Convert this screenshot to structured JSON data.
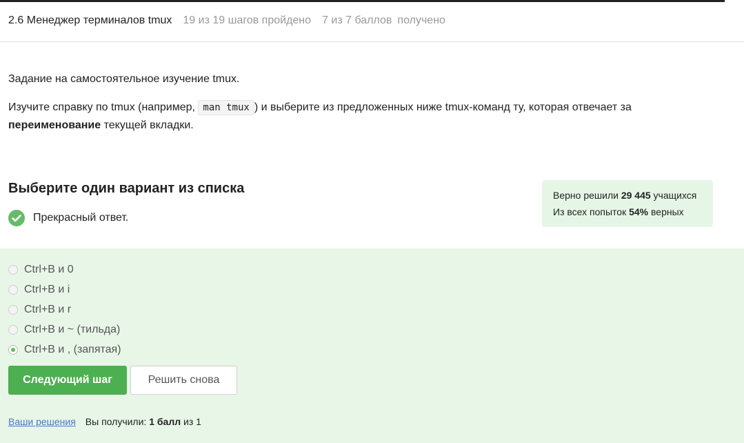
{
  "header": {
    "lesson_title": "2.6 Менеджер терминалов tmux",
    "steps_progress": "19 из 19 шагов пройдено",
    "points": "7 из 7 баллов",
    "points_suffix": "получено"
  },
  "task": {
    "line1": "Задание на самостоятельное изучение tmux.",
    "line2_before": "Изучите справку по tmux (например, ",
    "line2_code": "man tmux",
    "line2_after": ") и выберите из предложенных ниже tmux-команд ту, которая отвечает за",
    "line3_bold": "переименование",
    "line3_after": " текущей вкладки."
  },
  "question": {
    "title": "Выберите один вариант из списка",
    "feedback": "Прекрасный ответ."
  },
  "stats": {
    "solved_prefix": "Верно решили ",
    "solved_count": "29 445",
    "solved_suffix": " учащихся",
    "attempts_prefix": "Из всех попыток ",
    "attempts_percent": "54%",
    "attempts_suffix": " верных"
  },
  "options": [
    {
      "label": "Ctrl+B и 0",
      "selected": false
    },
    {
      "label": "Ctrl+B и i",
      "selected": false
    },
    {
      "label": "Ctrl+B и r",
      "selected": false
    },
    {
      "label": "Ctrl+B и ~ (тильда)",
      "selected": false
    },
    {
      "label": "Ctrl+B и , (запятая)",
      "selected": true
    }
  ],
  "buttons": {
    "next": "Следующий шаг",
    "retry": "Решить снова"
  },
  "footer": {
    "solutions_link": "Ваши решения",
    "result_prefix": "Вы получили: ",
    "result_bold": "1 балл",
    "result_suffix": " из 1"
  },
  "colors": {
    "accent_green": "#4caf50",
    "answer_bg": "#e8f6e8",
    "stats_bg": "#e6f6e6",
    "link": "#4a78c2"
  }
}
